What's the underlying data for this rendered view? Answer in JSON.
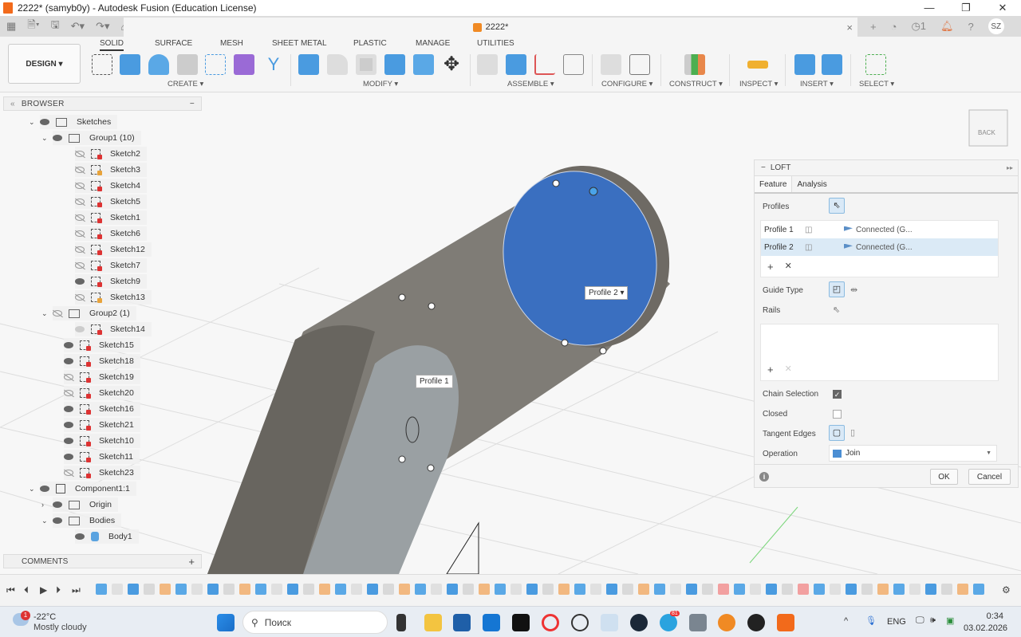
{
  "window": {
    "title": "2222* (samyb0y) - Autodesk Fusion (Education License)",
    "minimize": "—",
    "maximize": "❐",
    "close": "✕"
  },
  "doc_tab": {
    "name": "2222*",
    "close": "×"
  },
  "topright": {
    "plus": "+",
    "jobs": "1",
    "user_initials": "SZ"
  },
  "ribbon": {
    "workspace": "DESIGN ▾",
    "tabs": [
      "SOLID",
      "SURFACE",
      "MESH",
      "SHEET METAL",
      "PLASTIC",
      "MANAGE",
      "UTILITIES"
    ],
    "active_tab": "SOLID",
    "groups": [
      "CREATE ▾",
      "MODIFY ▾",
      "ASSEMBLE ▾",
      "CONFIGURE ▾",
      "CONSTRUCT ▾",
      "INSPECT ▾",
      "INSERT ▾",
      "SELECT ▾"
    ]
  },
  "browser": {
    "title": "BROWSER",
    "items": [
      {
        "label": "Sketches",
        "level": 0,
        "type": "folder",
        "eye": "on",
        "chev": "v"
      },
      {
        "label": "Group1 (10)",
        "level": 1,
        "type": "folder",
        "eye": "on",
        "chev": "v"
      },
      {
        "label": "Sketch2",
        "level": 2,
        "type": "sketch",
        "eye": "off"
      },
      {
        "label": "Sketch3",
        "level": 2,
        "type": "sketch-edit",
        "eye": "off"
      },
      {
        "label": "Sketch4",
        "level": 2,
        "type": "sketch",
        "eye": "off"
      },
      {
        "label": "Sketch5",
        "level": 2,
        "type": "sketch",
        "eye": "off"
      },
      {
        "label": "Sketch1",
        "level": 2,
        "type": "sketch",
        "eye": "off"
      },
      {
        "label": "Sketch6",
        "level": 2,
        "type": "sketch",
        "eye": "off"
      },
      {
        "label": "Sketch12",
        "level": 2,
        "type": "sketch",
        "eye": "off"
      },
      {
        "label": "Sketch7",
        "level": 2,
        "type": "sketch",
        "eye": "off"
      },
      {
        "label": "Sketch9",
        "level": 2,
        "type": "sketch",
        "eye": "on"
      },
      {
        "label": "Sketch13",
        "level": 2,
        "type": "sketch-edit",
        "eye": "off"
      },
      {
        "label": "Group2 (1)",
        "level": 1,
        "type": "folder",
        "eye": "off",
        "chev": "v"
      },
      {
        "label": "Sketch14",
        "level": 2,
        "type": "sketch",
        "eye": "dim"
      },
      {
        "label": "Sketch15",
        "level": 1,
        "type": "sketch",
        "eye": "on"
      },
      {
        "label": "Sketch18",
        "level": 1,
        "type": "sketch",
        "eye": "on"
      },
      {
        "label": "Sketch19",
        "level": 1,
        "type": "sketch",
        "eye": "off"
      },
      {
        "label": "Sketch20",
        "level": 1,
        "type": "sketch",
        "eye": "off"
      },
      {
        "label": "Sketch16",
        "level": 1,
        "type": "sketch",
        "eye": "on"
      },
      {
        "label": "Sketch21",
        "level": 1,
        "type": "sketch",
        "eye": "on"
      },
      {
        "label": "Sketch10",
        "level": 1,
        "type": "sketch",
        "eye": "on"
      },
      {
        "label": "Sketch11",
        "level": 1,
        "type": "sketch",
        "eye": "on"
      },
      {
        "label": "Sketch23",
        "level": 1,
        "type": "sketch",
        "eye": "off"
      },
      {
        "label": "Component1:1",
        "level": 0,
        "type": "component",
        "eye": "on",
        "chev": "v"
      },
      {
        "label": "Origin",
        "level": 1,
        "type": "folder",
        "eye": "on",
        "chev": ">"
      },
      {
        "label": "Bodies",
        "level": 1,
        "type": "folder",
        "eye": "on",
        "chev": "v"
      },
      {
        "label": "Body1",
        "level": 2,
        "type": "body",
        "eye": "on"
      }
    ]
  },
  "comments": {
    "title": "COMMENTS",
    "add": "+"
  },
  "viewcube": {
    "face": "BACK"
  },
  "viewport_labels": {
    "profile1": "Profile 1",
    "profile2": "Profile 2 ▾"
  },
  "loft": {
    "title": "LOFT",
    "tabs": [
      "Feature",
      "Analysis"
    ],
    "profiles_label": "Profiles",
    "profiles": [
      {
        "name": "Profile 1",
        "condition": "Connected (G..."
      },
      {
        "name": "Profile 2",
        "condition": "Connected (G..."
      }
    ],
    "add": "+",
    "remove": "✕",
    "guide_type_label": "Guide Type",
    "rails_label": "Rails",
    "chain_selection_label": "Chain Selection",
    "chain_selection": true,
    "closed_label": "Closed",
    "closed": false,
    "tangent_edges_label": "Tangent Edges",
    "operation_label": "Operation",
    "operation": "Join",
    "ok": "OK",
    "cancel": "Cancel"
  },
  "taskbar": {
    "weather_temp": "-22°C",
    "weather_desc": "Mostly cloudy",
    "weather_badge": "1",
    "search_placeholder": "Поиск",
    "lang": "ENG",
    "time": "0:34",
    "date": "03.02.2026",
    "telegram_badge": "81"
  },
  "colors": {
    "accent": "#3d7cc9",
    "profile_fill": "#3a6fc0",
    "body_gray": "#75726c",
    "fusion_orange": "#f26a1b"
  }
}
